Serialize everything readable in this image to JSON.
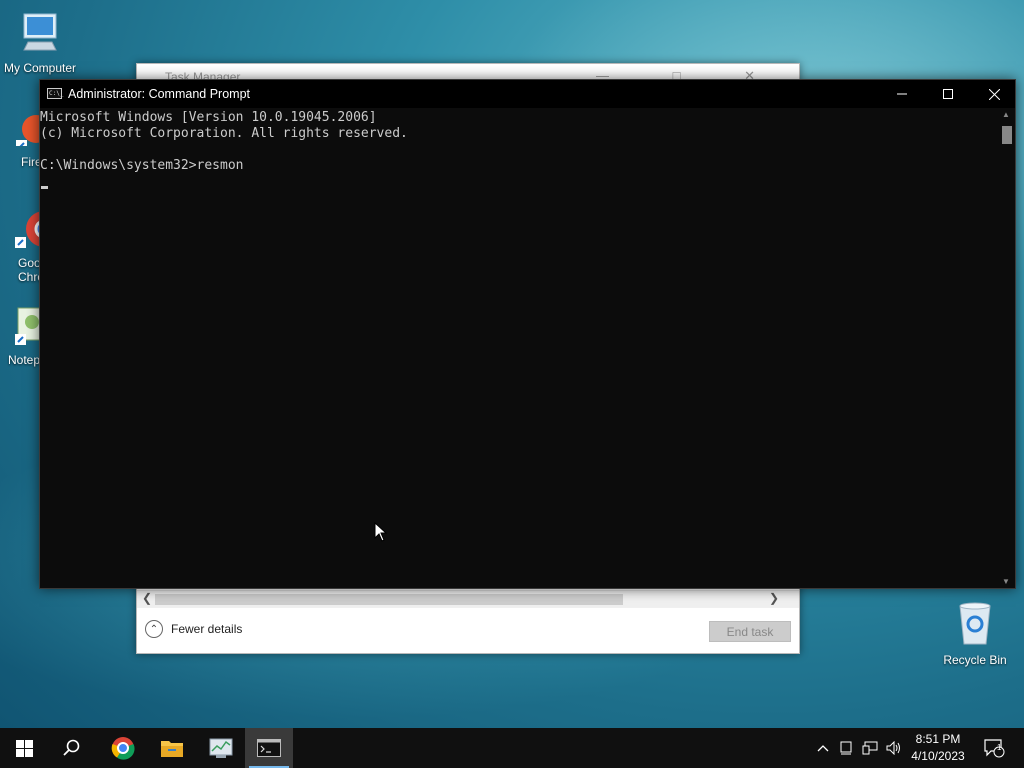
{
  "desktop": {
    "icons": [
      {
        "label": "My Computer"
      },
      {
        "label": "Fire"
      },
      {
        "label": "Goo\nChro"
      },
      {
        "label": "Notep"
      },
      {
        "label": "Recycle Bin"
      }
    ]
  },
  "task_manager": {
    "title": "Task Manager",
    "fewer_details": "Fewer details",
    "end_task": "End task"
  },
  "cmd": {
    "title": "Administrator: Command Prompt",
    "icon_text": "C:\\_",
    "lines": [
      "Microsoft Windows [Version 10.0.19045.2006]",
      "(c) Microsoft Corporation. All rights reserved.",
      "",
      "C:\\Windows\\system32>resmon"
    ]
  },
  "taskbar": {
    "time": "8:51 PM",
    "date": "4/10/2023",
    "notification_count": "1"
  }
}
